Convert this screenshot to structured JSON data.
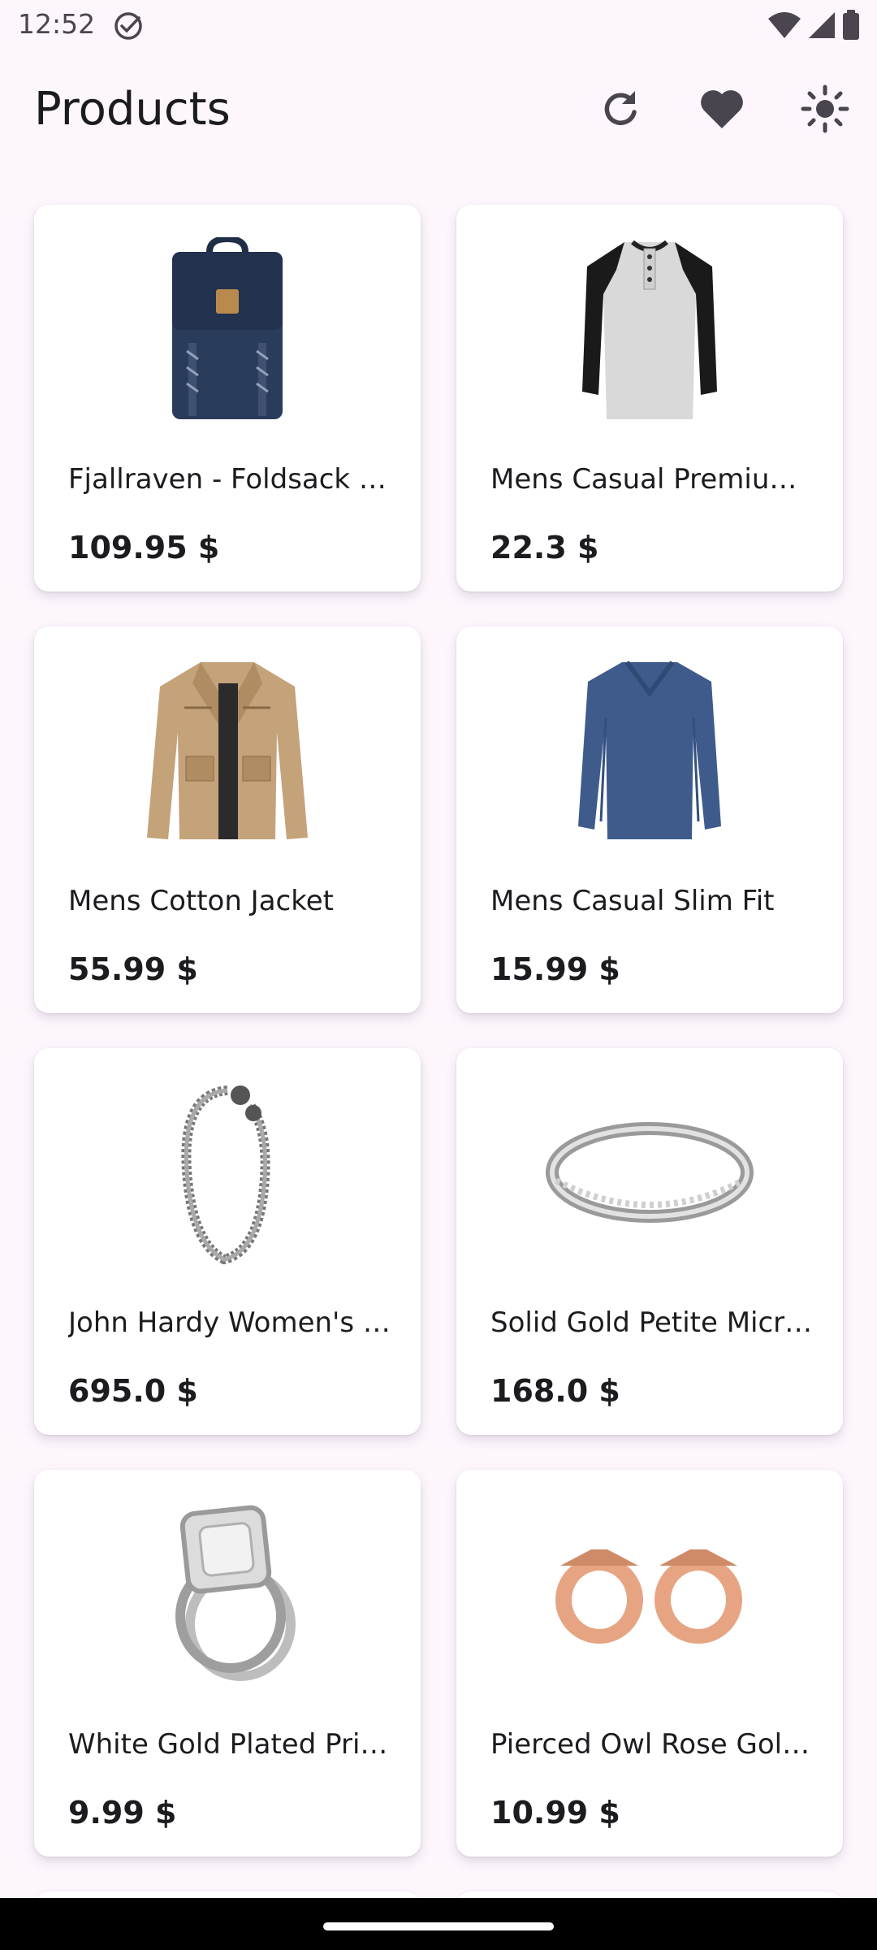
{
  "status_bar": {
    "time": "12:52"
  },
  "app_bar": {
    "title": "Products"
  },
  "products": [
    {
      "title": "Fjallraven - Foldsack …",
      "price": "109.95 $",
      "image": "backpack"
    },
    {
      "title": "Mens Casual Premiu…",
      "price": "22.3 $",
      "image": "raglan-shirt"
    },
    {
      "title": "Mens Cotton Jacket",
      "price": "55.99 $",
      "image": "jacket"
    },
    {
      "title": "Mens Casual Slim Fit",
      "price": "15.99 $",
      "image": "long-sleeve-shirt"
    },
    {
      "title": "John Hardy Women's …",
      "price": "695.0 $",
      "image": "bracelet"
    },
    {
      "title": "Solid Gold Petite Micr…",
      "price": "168.0 $",
      "image": "ring-band"
    },
    {
      "title": "White Gold Plated Pri…",
      "price": "9.99 $",
      "image": "engagement-ring"
    },
    {
      "title": "Pierced Owl Rose Gol…",
      "price": "10.99 $",
      "image": "ear-tunnels"
    }
  ],
  "colors": {
    "background": "#fdf7fd",
    "card": "#ffffff",
    "text": "#1c1b1f",
    "icon": "#49454f"
  }
}
